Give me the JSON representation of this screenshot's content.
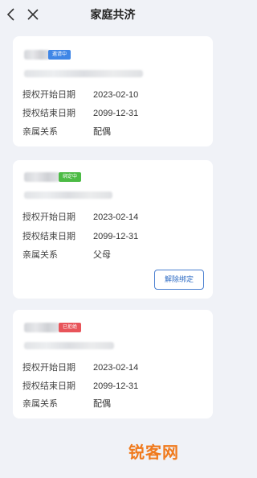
{
  "header": {
    "title": "家庭共济",
    "back_icon": "chevron-left-icon",
    "close_icon": "close-icon"
  },
  "cards": [
    {
      "badge": "邀请中",
      "badge_color": "#3f86e6",
      "rows": [
        {
          "label": "授权开始日期",
          "value": "2023-02-10"
        },
        {
          "label": "授权结束日期",
          "value": "2099-12-31"
        },
        {
          "label": "亲属关系",
          "value": "配偶"
        }
      ]
    },
    {
      "badge": "绑定中",
      "badge_color": "#4cbb45",
      "rows": [
        {
          "label": "授权开始日期",
          "value": "2023-02-14"
        },
        {
          "label": "授权结束日期",
          "value": "2099-12-31"
        },
        {
          "label": "亲属关系",
          "value": "父母"
        }
      ],
      "action_label": "解除绑定"
    },
    {
      "badge": "已拒绝",
      "badge_color": "#e8545a",
      "rows": [
        {
          "label": "授权开始日期",
          "value": "2023-02-14"
        },
        {
          "label": "授权结束日期",
          "value": "2099-12-31"
        },
        {
          "label": "亲属关系",
          "value": "配偶"
        }
      ]
    }
  ],
  "watermark": "锐客网"
}
